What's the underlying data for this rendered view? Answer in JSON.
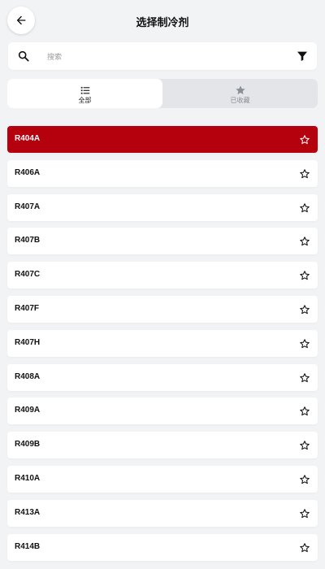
{
  "header": {
    "title": "选择制冷剂",
    "back_icon": "arrow-left-icon"
  },
  "search": {
    "placeholder": "搜索",
    "value": "",
    "search_icon": "search-icon",
    "filter_icon": "filter-icon"
  },
  "tabs": [
    {
      "label": "全部",
      "icon": "list-icon",
      "active": true
    },
    {
      "label": "已收藏",
      "icon": "star-icon",
      "active": false
    }
  ],
  "colors": {
    "accent": "#b5000e",
    "background": "#f2f3f5",
    "card": "#ffffff",
    "inactive_text": "#8a8f96"
  },
  "refrigerants": [
    {
      "name": "R404A",
      "selected": true,
      "favorite": false
    },
    {
      "name": "R406A",
      "selected": false,
      "favorite": false
    },
    {
      "name": "R407A",
      "selected": false,
      "favorite": false
    },
    {
      "name": "R407B",
      "selected": false,
      "favorite": false
    },
    {
      "name": "R407C",
      "selected": false,
      "favorite": false
    },
    {
      "name": "R407F",
      "selected": false,
      "favorite": false
    },
    {
      "name": "R407H",
      "selected": false,
      "favorite": false
    },
    {
      "name": "R408A",
      "selected": false,
      "favorite": false
    },
    {
      "name": "R409A",
      "selected": false,
      "favorite": false
    },
    {
      "name": "R409B",
      "selected": false,
      "favorite": false
    },
    {
      "name": "R410A",
      "selected": false,
      "favorite": false
    },
    {
      "name": "R413A",
      "selected": false,
      "favorite": false
    },
    {
      "name": "R414B",
      "selected": false,
      "favorite": false
    }
  ]
}
